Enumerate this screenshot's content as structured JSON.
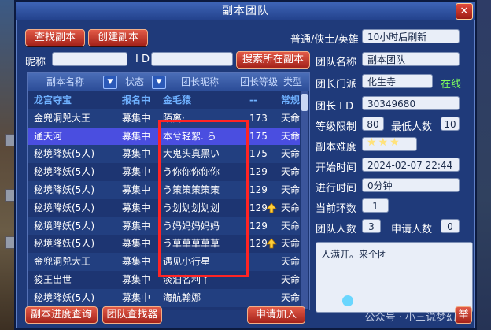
{
  "window": {
    "title": "副本团队",
    "close_label": "✕"
  },
  "toolbar": {
    "find_label": "查找副本",
    "create_label": "创建副本",
    "mode_label": "普通/侠士/英雄",
    "refresh_value": "10小时后刷新"
  },
  "search": {
    "nickname_label": "昵称",
    "nickname_value": "",
    "id_label": "I D",
    "id_value": "",
    "search_label": "搜索所在副本"
  },
  "list": {
    "columns": [
      "副本名称",
      "状态",
      "团长昵称",
      "团长等级",
      "类型"
    ],
    "rows": [
      {
        "name": "龙宫夺宝",
        "status": "报名中",
        "leader": "金毛猿",
        "level": "--",
        "type": "常规"
      },
      {
        "name": "金兜洞兕大王",
        "status": "募集中",
        "leader": "陌离·",
        "level": "173",
        "type": "天命"
      },
      {
        "name": "通天河",
        "status": "募集中",
        "leader": "本兮轻絮. ら",
        "level": "175",
        "type": "天命"
      },
      {
        "name": "秘境降妖(5人)",
        "status": "募集中",
        "leader": "大鬼头真黑い",
        "level": "175",
        "type": "天命"
      },
      {
        "name": "秘境降妖(5人)",
        "status": "募集中",
        "leader": "う你你你你你",
        "level": "129",
        "type": "天命"
      },
      {
        "name": "秘境降妖(5人)",
        "status": "募集中",
        "leader": "う策策策策策",
        "level": "129",
        "type": "天命"
      },
      {
        "name": "秘境降妖(5人)",
        "status": "募集中",
        "leader": "う划划划划划",
        "level": "129",
        "type": "天命"
      },
      {
        "name": "秘境降妖(5人)",
        "status": "募集中",
        "leader": "う妈妈妈妈妈",
        "level": "129",
        "type": "天命"
      },
      {
        "name": "秘境降妖(5人)",
        "status": "募集中",
        "leader": "う草草草草草",
        "level": "129",
        "type": "天命"
      },
      {
        "name": "金兜洞兕大王",
        "status": "募集中",
        "leader": "遇见小行星",
        "level": "",
        "type": "天命"
      },
      {
        "name": "狻王出世",
        "status": "募集中",
        "leader": "淡泊名利丫",
        "level": "",
        "type": "天命"
      },
      {
        "name": "秘境降妖(5人)",
        "status": "募集中",
        "leader": "海航翰娜",
        "level": "",
        "type": "天命"
      }
    ],
    "up_icon_rows": [
      6,
      8
    ]
  },
  "team": {
    "name_label": "团队名称",
    "name_value": "副本团队",
    "sect_label": "团长门派",
    "sect_value": "化生寺",
    "online_label": "在线",
    "id_label": "团长 I D",
    "id_value": "30349680",
    "level_label": "等级限制",
    "level_value": "80",
    "min_label": "最低人数",
    "min_value": "10",
    "difficulty_label": "副本难度",
    "difficulty_value": "★★★",
    "start_label": "开始时间",
    "start_value": "2024-02-07 22:44",
    "elapsed_label": "进行时间",
    "elapsed_value": "0分钟",
    "ring_label": "当前环数",
    "ring_value": "1",
    "members_label": "团队人数",
    "members_value": "3",
    "applicants_label": "申请人数",
    "applicants_value": "0",
    "note": "人满开。来个团"
  },
  "bottom": {
    "progress_label": "副本进度查询",
    "finder_label": "团队查找器",
    "apply_label": "申请加入",
    "extra_label": "举"
  },
  "watermark": {
    "text": "公众号 · 小三说梦幻"
  }
}
